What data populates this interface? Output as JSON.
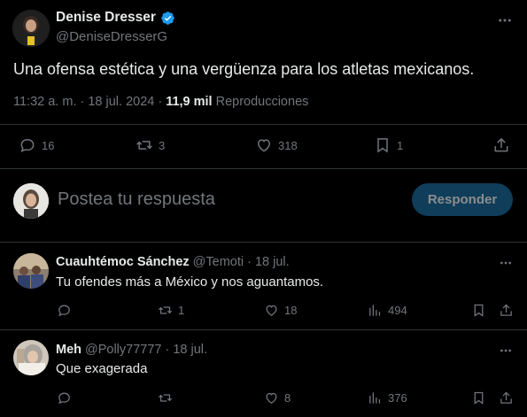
{
  "main_tweet": {
    "author_name": "Denise Dresser",
    "author_handle": "@DeniseDresserG",
    "text": "Una ofensa estética y una vergüenza para los atletas mexicanos.",
    "time": "11:32 a. m. · 18 jul. 2024 ·",
    "views_count": "11,9 mil",
    "views_label": "Reproducciones",
    "replies": "16",
    "retweets": "3",
    "likes": "318",
    "bookmarks": "1"
  },
  "composer": {
    "placeholder": "Postea tu respuesta",
    "button_label": "Responder"
  },
  "replies": [
    {
      "name": "Cuauhtémoc Sánchez",
      "handle": "@Temoti",
      "date": "· 18 jul.",
      "text": "Tu ofendes más a México y nos aguantamos.",
      "replies": "",
      "retweets": "1",
      "likes": "18",
      "views": "494"
    },
    {
      "name": "Meh",
      "handle": "@Polly77777",
      "date": "· 18 jul.",
      "text": "Que exagerada",
      "replies": "",
      "retweets": "",
      "likes": "8",
      "views": "376"
    }
  ],
  "colors": {
    "background": "#000000",
    "text": "#e7e9ea",
    "muted": "#71767b",
    "accent": "#1d9bf0",
    "divider": "#2f3336"
  }
}
